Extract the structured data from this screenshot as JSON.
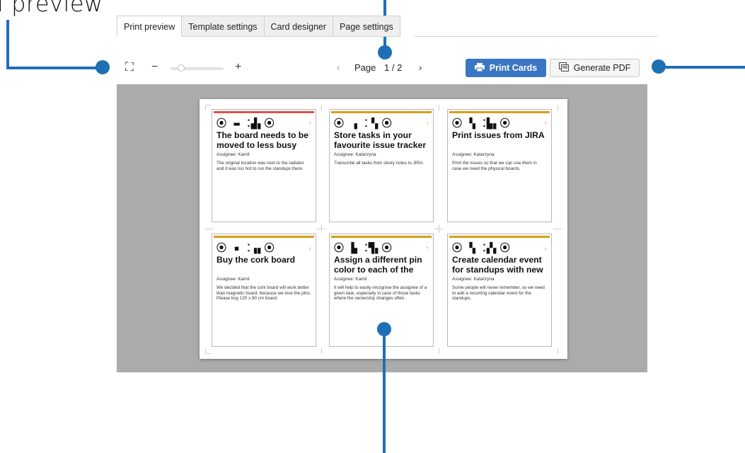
{
  "annotation": {
    "label": "l preview"
  },
  "tabs": [
    {
      "label": "Print preview"
    },
    {
      "label": "Template settings"
    },
    {
      "label": "Card designer"
    },
    {
      "label": "Page settings"
    }
  ],
  "toolbar": {
    "fullscreen_glyph": "⛶",
    "zoom_out": "−",
    "zoom_in": "+",
    "zoom_level": 0.2,
    "prev_arrow": "‹",
    "next_arrow": "›",
    "page_label": "Page",
    "page_value": "1 / 2",
    "print_label": "Print Cards",
    "pdf_label": "Generate PDF"
  },
  "colors": {
    "accent": "#3a76c4",
    "annotation": "#1f6fb5",
    "bar_red": "#d9534f",
    "bar_orange": "#d4a017",
    "prio_up": "#e06a2c",
    "prio_down": "#4caf50"
  },
  "cards": [
    {
      "qr": "⦿ ▬ ⁚▟▖⦿",
      "bar": "#d9534f",
      "prio": "↑",
      "prio_color": "#e06a2c",
      "title": "The board needs to be moved to less busy place",
      "assignee": "Assignee: Kamil",
      "desc": "The original location was next to the radiator and it was too hot to run the standups there."
    },
    {
      "qr": "⦿ ▗ ⁚▝▖⦿",
      "bar": "#d4a017",
      "prio": "↑",
      "prio_color": "#e06a2c",
      "title": "Store tasks in your favourite issue tracker",
      "assignee": "Assignee: Katarzyna",
      "desc": "Transcribe all tasks from sticky notes to JIRA."
    },
    {
      "qr": "⦿ ▚ ⁚▙▖⦿",
      "bar": "#d4a017",
      "prio": "↑",
      "prio_color": "#e06a2c",
      "title": "Print issues from JIRA",
      "assignee": "Assignee: Katarzyna",
      "desc": "Print the issues so that we can use them in case we need the physical boards."
    },
    {
      "qr": "⦿ ▪ ⁚▗▖⦿",
      "bar": "#d4a017",
      "prio": "↓",
      "prio_color": "#4caf50",
      "title": "Buy the cork board",
      "assignee": "Assignee: Kamil",
      "desc": "We decided that the cork board will work better than magnetic board, because we love the pins. Please buy 120 x 80 cm board."
    },
    {
      "qr": "⦿ ▙ ⁚▜▖⦿",
      "bar": "#d4a017",
      "prio": "↑",
      "prio_color": "#e06a2c",
      "title": "Assign a different pin color to each of the",
      "assignee": "Assignee: Kamil",
      "desc": "It will help to easily recognise the assignee of a given task, especially in case of those tasks where the ownership changes often."
    },
    {
      "qr": "⦿ ▚ ⁚▞▖⦿",
      "bar": "#d4a017",
      "prio": "↓",
      "prio_color": "#4caf50",
      "title": "Create calendar event for standups with new",
      "assignee": "Assignee: Katarzyna",
      "desc": "Some people will never remember, so we need to add a recurring calendar event for the standups."
    }
  ]
}
